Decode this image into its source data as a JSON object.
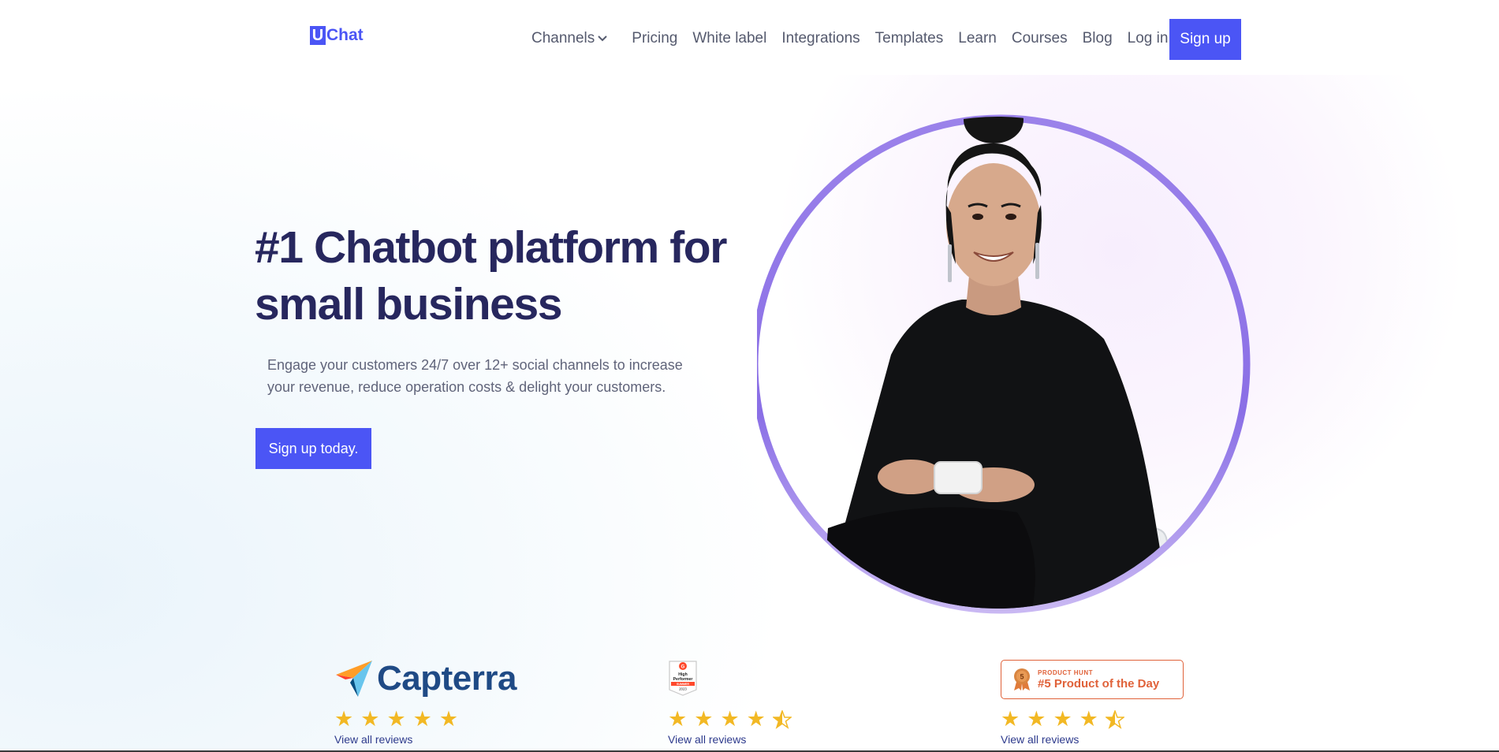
{
  "brand": {
    "logo_letter": "U",
    "logo_text": "Chat",
    "accent_color": "#4b55f5",
    "heading_color": "#27275e"
  },
  "nav": {
    "items": [
      {
        "label": "Channels",
        "has_dropdown": true
      },
      {
        "label": "Pricing"
      },
      {
        "label": "White label"
      },
      {
        "label": "Integrations"
      },
      {
        "label": "Templates"
      },
      {
        "label": "Learn"
      },
      {
        "label": "Courses"
      },
      {
        "label": "Blog"
      },
      {
        "label": "Log in"
      }
    ],
    "signup_label": "Sign up"
  },
  "hero": {
    "headline_line1": "#1 Chatbot platform for",
    "headline_line2": "small business",
    "subtext_line1": "Engage your customers 24/7 over 12+ social channels to increase",
    "subtext_line2": "your revenue, reduce operation costs & delight your customers.",
    "cta_label": "Sign up today."
  },
  "reviews": [
    {
      "source": "Capterra",
      "rating": 5,
      "link_label": "View all reviews"
    },
    {
      "source": "G2",
      "badge_lines": [
        "High",
        "Performer",
        "SUMMER",
        "2023"
      ],
      "rating": 4.5,
      "link_label": "View all reviews"
    },
    {
      "source": "Product Hunt",
      "badge_small": "PRODUCT HUNT",
      "badge_big": "#5 Product of the Day",
      "medal_number": "5",
      "rating": 4.5,
      "link_label": "View all reviews"
    }
  ],
  "icons": {
    "dropdown": "chevron-down-icon",
    "capterra_logo": "capterra-arrow-icon",
    "star_full": "star-icon",
    "star_half": "star-half-icon",
    "medal": "medal-icon"
  }
}
